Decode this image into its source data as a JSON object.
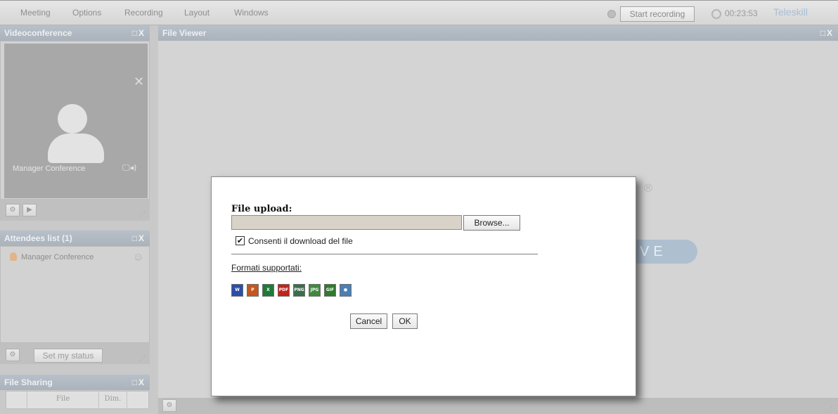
{
  "menu": {
    "items": [
      "Meeting",
      "Options",
      "Recording",
      "Layout",
      "Windows"
    ],
    "record_button": "Start recording",
    "timer": "00:23:53",
    "brand": "Teleskill"
  },
  "panels": {
    "videoconference": {
      "title": "Videoconference",
      "controls": "□X",
      "participant_label": "Manager Conference"
    },
    "attendees": {
      "title": "Attendees list (1)",
      "controls": "□X",
      "items": [
        "Manager Conference"
      ],
      "status_button": "Set my status"
    },
    "file_sharing": {
      "title": "File Sharing",
      "controls": "□X",
      "columns": [
        "File",
        "Dim."
      ]
    },
    "file_viewer": {
      "title": "File Viewer",
      "controls": "□X",
      "logo_suffix": "VE",
      "logo_mark": "®"
    }
  },
  "dialog": {
    "title": "File upload:",
    "browse_label": "Browse...",
    "checkbox_checked": true,
    "checkbox_label": "Consenti il download del file",
    "formats_link": "Formati supportati:",
    "formats": [
      {
        "name": "word-icon",
        "label": "W",
        "color": "#2b4fa8"
      },
      {
        "name": "powerpoint-icon",
        "label": "P",
        "color": "#c4571d"
      },
      {
        "name": "excel-icon",
        "label": "X",
        "color": "#1f7a3a"
      },
      {
        "name": "pdf-icon",
        "label": "PDF",
        "color": "#c2241a"
      },
      {
        "name": "png-icon",
        "label": "PNG",
        "color": "#3c6c4e"
      },
      {
        "name": "jpg-icon",
        "label": "JPG",
        "color": "#3e8a3e"
      },
      {
        "name": "gif-icon",
        "label": "GIF",
        "color": "#2f7a2f"
      },
      {
        "name": "media-icon",
        "label": "●",
        "color": "#4b7fb5"
      }
    ],
    "cancel_label": "Cancel",
    "ok_label": "OK"
  }
}
